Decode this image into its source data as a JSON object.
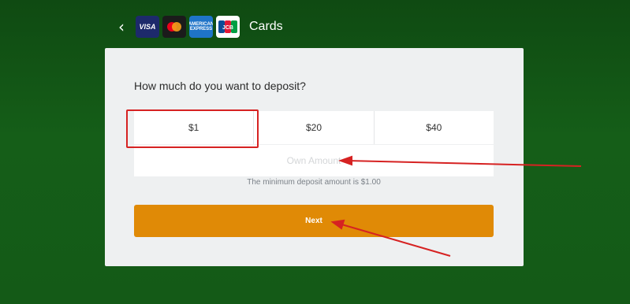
{
  "header": {
    "back_icon": "chevron-left-icon",
    "title": "Cards",
    "logos": [
      {
        "name": "visa-logo",
        "text": "VISA"
      },
      {
        "name": "mastercard-logo",
        "text": ""
      },
      {
        "name": "amex-logo",
        "text": "AMERICAN EXPRESS"
      },
      {
        "name": "jcb-logo",
        "text": "JCB"
      }
    ]
  },
  "deposit": {
    "question": "How much do you want to deposit?",
    "amounts": [
      "$1",
      "$20",
      "$40"
    ],
    "own_amount_placeholder": "Own Amount",
    "own_amount_value": "",
    "min_note": "The minimum deposit amount is $1.00",
    "next_label": "Next"
  },
  "annotation_color": "#d62222"
}
